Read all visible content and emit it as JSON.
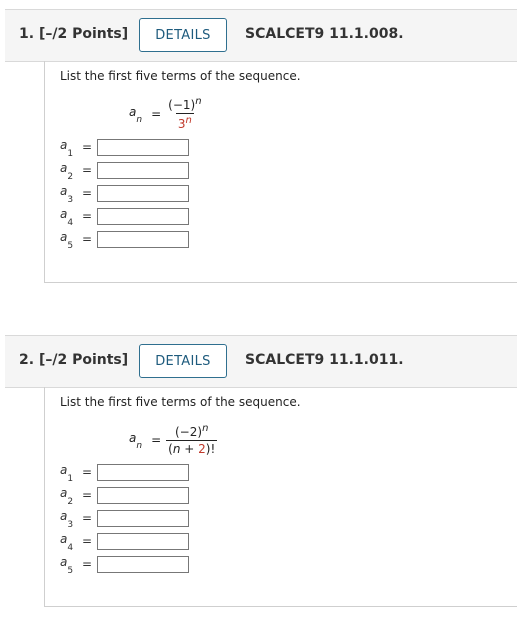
{
  "questions": [
    {
      "number": "1.",
      "points": "[–/2 Points]",
      "details_label": "DETAILS",
      "code": "SCALCET9 11.1.008.",
      "instruction": "List the first five terms of the sequence.",
      "formula": {
        "lhs": "a",
        "lhs_sub": "n",
        "eq": "=",
        "num_base": "(−1)",
        "num_exp": "n",
        "den_base": "3",
        "den_exp": "n"
      },
      "answers": [
        {
          "label": "a",
          "sub": "1",
          "value": ""
        },
        {
          "label": "a",
          "sub": "2",
          "value": ""
        },
        {
          "label": "a",
          "sub": "3",
          "value": ""
        },
        {
          "label": "a",
          "sub": "4",
          "value": ""
        },
        {
          "label": "a",
          "sub": "5",
          "value": ""
        }
      ]
    },
    {
      "number": "2.",
      "points": "[–/2 Points]",
      "details_label": "DETAILS",
      "code": "SCALCET9 11.1.011.",
      "instruction": "List the first five terms of the sequence.",
      "formula": {
        "lhs": "a",
        "lhs_sub": "n",
        "eq": "=",
        "num_base": "(−2)",
        "num_exp": "n",
        "den_open": "(",
        "den_var": "n",
        "den_plus": " + ",
        "den_const": "2",
        "den_close": ")!"
      },
      "answers": [
        {
          "label": "a",
          "sub": "1",
          "value": ""
        },
        {
          "label": "a",
          "sub": "2",
          "value": ""
        },
        {
          "label": "a",
          "sub": "3",
          "value": ""
        },
        {
          "label": "a",
          "sub": "4",
          "value": ""
        },
        {
          "label": "a",
          "sub": "5",
          "value": ""
        }
      ]
    }
  ],
  "colors": {
    "details_border": "#2f6f8f",
    "details_text": "#1e5b7d",
    "highlight_red": "#c0392b",
    "header_bg": "#f5f5f5"
  }
}
